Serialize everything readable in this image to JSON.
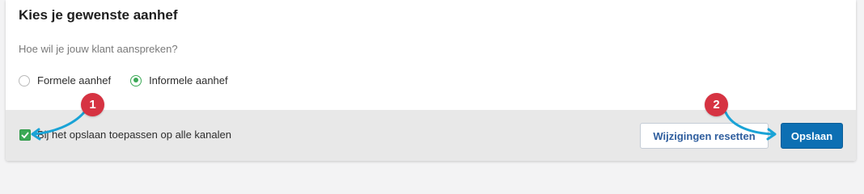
{
  "panel": {
    "title": "Kies je gewenste aanhef",
    "question": "Hoe wil je jouw klant aanspreken?",
    "options": [
      {
        "label": "Formele aanhef",
        "selected": false
      },
      {
        "label": "Informele aanhef",
        "selected": true
      }
    ]
  },
  "footer": {
    "apply_all_label": "Bij het opslaan toepassen op alle kanalen",
    "apply_all_checked": true,
    "reset_label": "Wijzigingen resetten",
    "save_label": "Opslaan"
  },
  "annotations": {
    "step1": "1",
    "step2": "2"
  },
  "colors": {
    "accent_green": "#3ba956",
    "primary_blue": "#0d6fb3",
    "badge_red": "#d63342",
    "arrow_cyan": "#1aa3d6"
  }
}
